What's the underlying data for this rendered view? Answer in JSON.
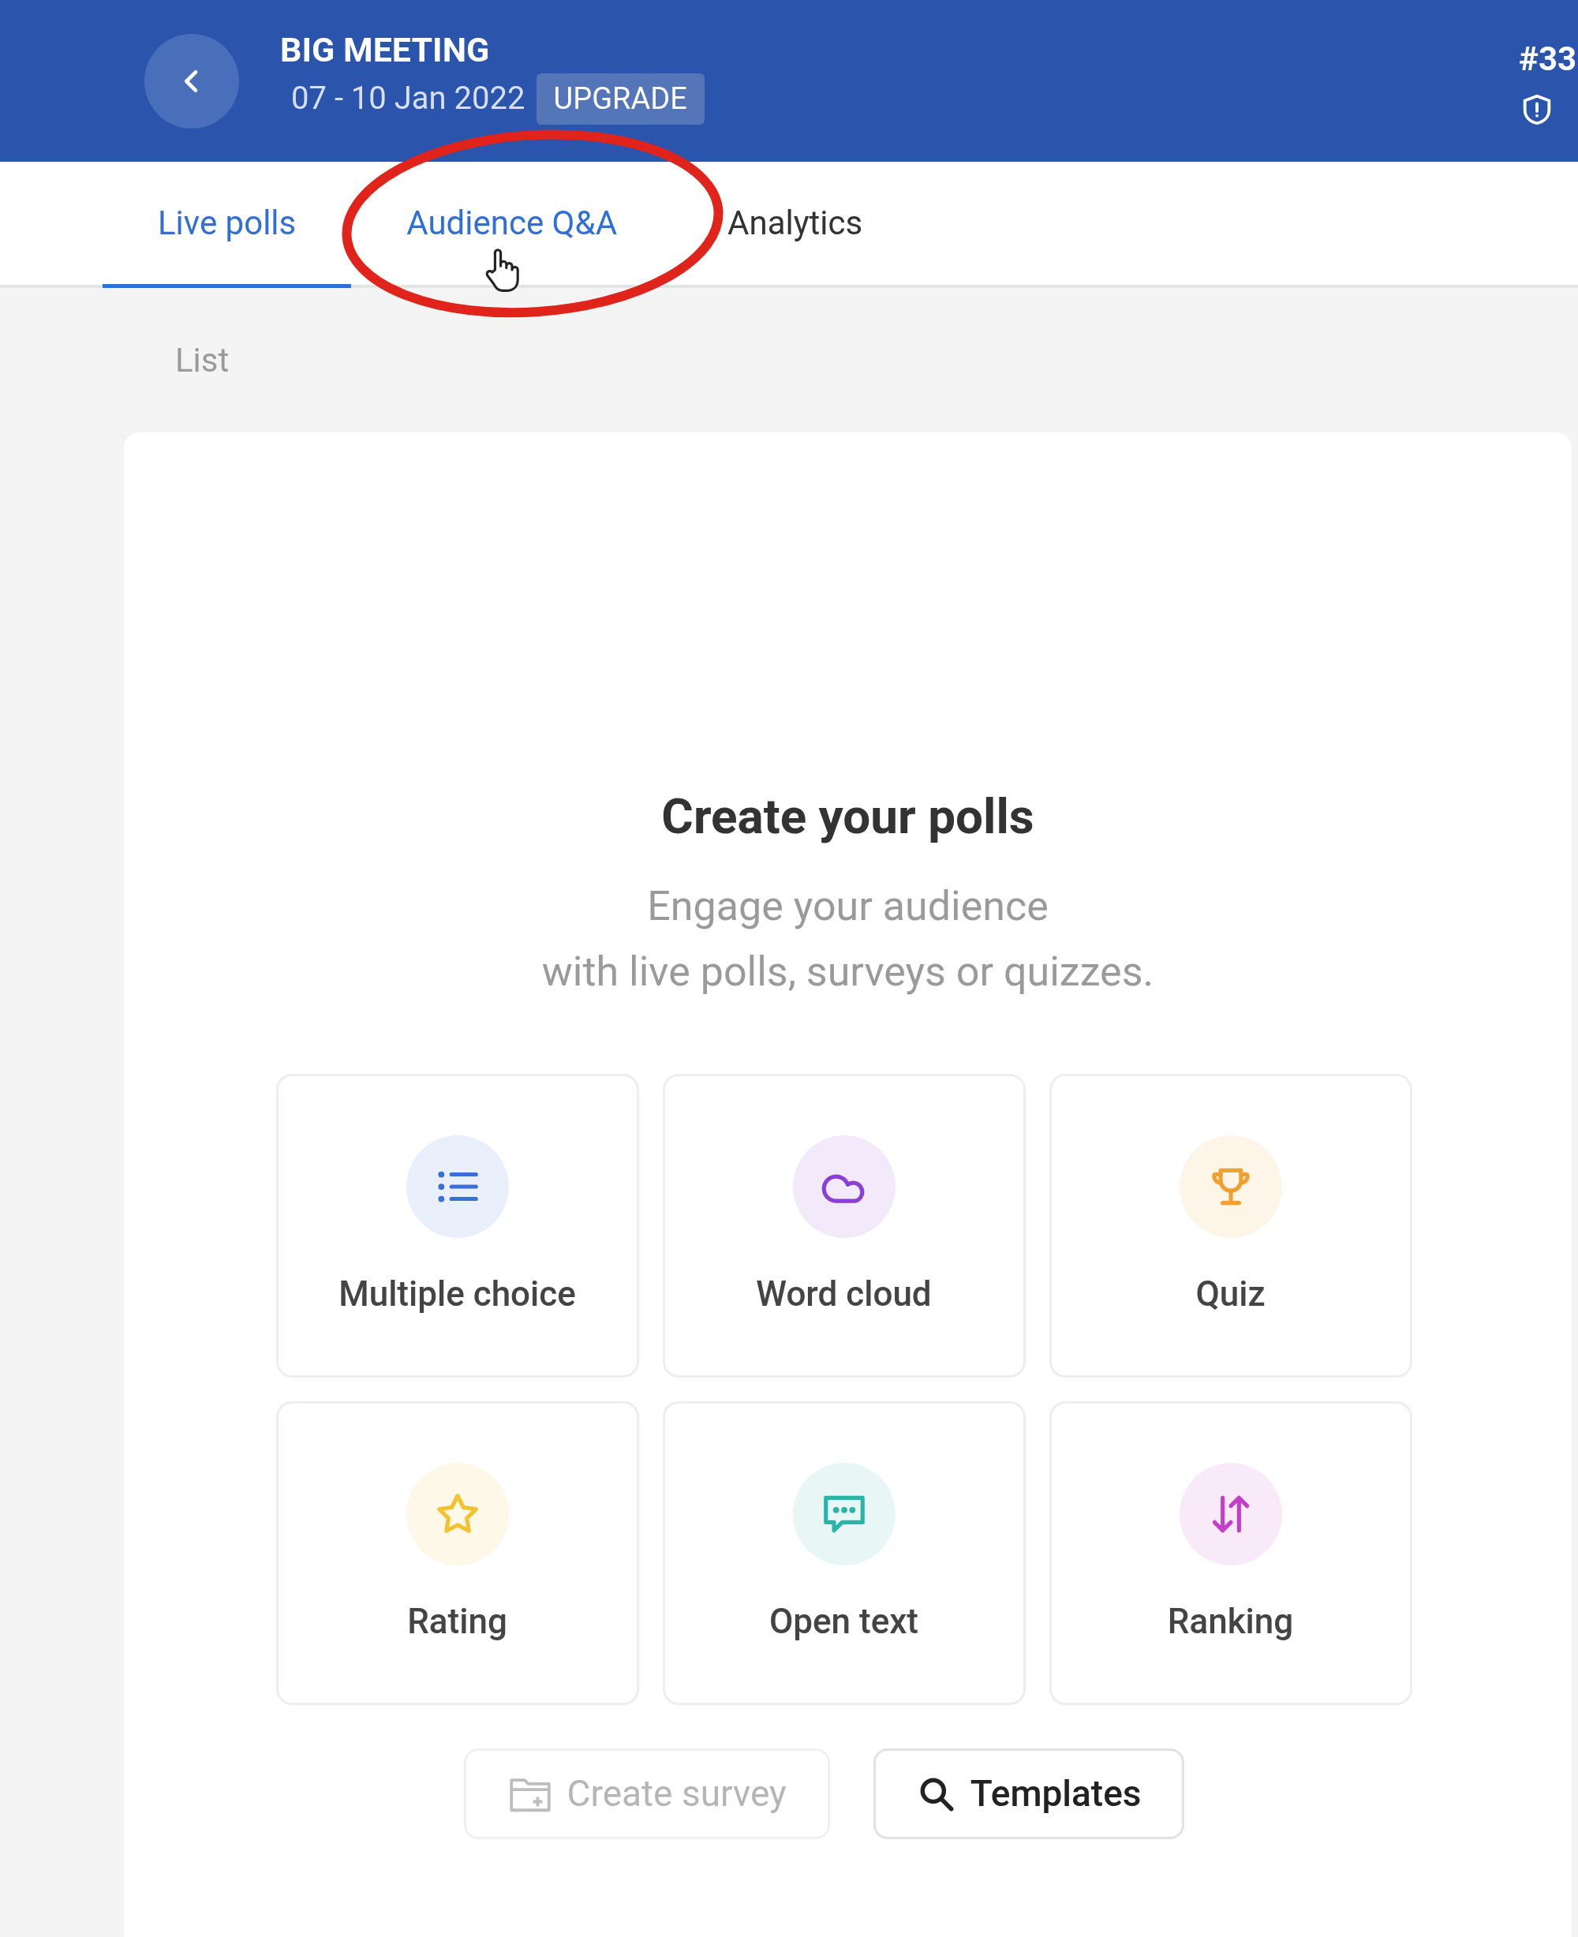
{
  "header": {
    "title": "BIG MEETING",
    "dates": "07 - 10 Jan 2022",
    "badge": "UPGRADE",
    "code": "#33"
  },
  "tabs": [
    {
      "label": "Live polls",
      "selected": true,
      "hovered": false
    },
    {
      "label": "Audience Q&A",
      "selected": false,
      "hovered": true
    },
    {
      "label": "Analytics",
      "selected": false,
      "hovered": false
    }
  ],
  "section_label": "List",
  "empty_state": {
    "title": "Create your polls",
    "lines": [
      "Engage your audience",
      "with live polls, surveys or quizzes."
    ]
  },
  "poll_types": [
    {
      "kind": "list",
      "label": "Multiple choice",
      "color": "#3b6fd8"
    },
    {
      "kind": "cloud",
      "label": "Word cloud",
      "color": "#8a3fd6"
    },
    {
      "kind": "trophy",
      "label": "Quiz",
      "color": "#f0a030"
    },
    {
      "kind": "star",
      "label": "Rating",
      "color": "#f2c230"
    },
    {
      "kind": "chat",
      "label": "Open text",
      "color": "#2bb3a8"
    },
    {
      "kind": "sort",
      "label": "Ranking",
      "color": "#c23fc8"
    }
  ],
  "actions": [
    {
      "kind": "folder",
      "label": "Create survey",
      "disabled": true
    },
    {
      "kind": "search",
      "label": "Templates",
      "disabled": false
    }
  ]
}
